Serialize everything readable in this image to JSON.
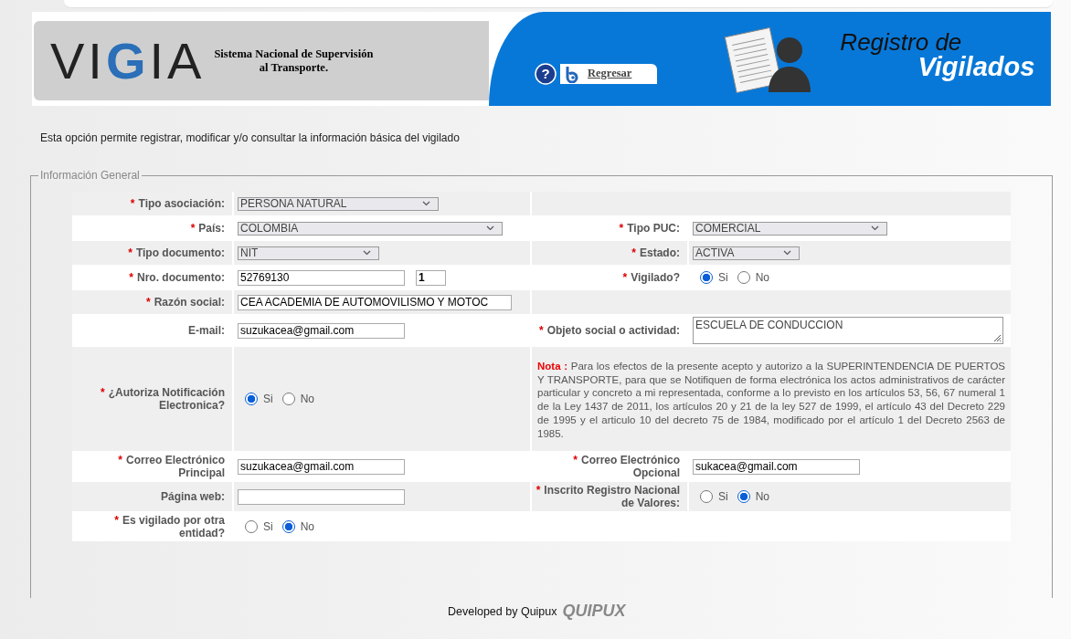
{
  "header": {
    "logo": "VIGIA",
    "system_name": [
      "Sistema Nacional de Supervisión",
      "al Transporte."
    ],
    "help": "?",
    "back_link": "Regresar",
    "title": [
      "Registro de",
      "Vigilados"
    ]
  },
  "intro": "Esta opción permite registrar, modificar y/o consultar la información básica del vigilado",
  "section": {
    "legend": "Información General",
    "rows": [
      {
        "left": {
          "label": "Tipo asociación:",
          "required_mark": "*",
          "kind": "select",
          "value": "PERSONA NATURAL"
        },
        "right": null
      },
      {
        "left": {
          "label": "País:",
          "required_mark": "*",
          "kind": "select",
          "value": "COLOMBIA"
        },
        "right": {
          "label": "Tipo PUC:",
          "required_mark": "*",
          "kind": "select",
          "value": "COMERCIAL"
        }
      },
      {
        "left": {
          "label": "Tipo documento:",
          "required_mark": "*",
          "kind": "select",
          "value": "NIT"
        },
        "right": {
          "label": "Estado:",
          "required_mark": "*",
          "kind": "select",
          "value": "ACTIVA"
        }
      },
      {
        "left": {
          "label": "Nro. documento:",
          "required_mark": "*",
          "kind": "text_pair",
          "value": "52769130",
          "value_2": "1"
        },
        "right": {
          "label": "Vigilado?",
          "required_mark": "*",
          "kind": "radio",
          "options": [
            {
              "label": "Si",
              "selected": true
            },
            {
              "label": "No",
              "selected": false
            }
          ]
        }
      },
      {
        "left": {
          "label": "Razón social:",
          "required_mark": "*",
          "kind": "text",
          "value": "CEA ACADEMIA DE AUTOMOVILISMO Y MOTOC"
        },
        "right": null
      },
      {
        "left": {
          "label": "E-mail:",
          "kind": "text",
          "value": "suzukacea@gmail.com"
        },
        "right": {
          "label": "Objeto social o actividad:",
          "required_mark": "*",
          "kind": "textarea",
          "value": "ESCUELA DE CONDUCCION"
        }
      },
      {
        "left": {
          "label": "¿Autoriza Notificación Electronica?",
          "required_mark": "*",
          "kind": "radio",
          "options": [
            {
              "label": "Si",
              "selected": true
            },
            {
              "label": "No",
              "selected": false
            }
          ]
        },
        "right": {
          "kind": "note",
          "text": "**Nota :** Para los efectos de la presente acepto y autorizo a la SUPERINTENDENCIA DE PUERTOS Y TRANSPORTE, para que se Notifiquen de forma electrónica los actos administrativos de carácter particular y concreto a mi representada, conforme a lo previsto en los artículos 53, 56, 67 numeral 1 de la Ley 1437 de 2011, los artículos 20 y 21 de la ley 527 de 1999, el artículo 43 del Decreto 229 de 1995 y el articulo 10 del decreto 75 de 1984, modificado por el artículo 1 del Decreto 2563 de 1985."
        }
      },
      {
        "left": {
          "label": "Correo Electrónico Principal",
          "required_mark": "*",
          "kind": "text",
          "value": "suzukacea@gmail.com"
        },
        "right": {
          "label": "Correo Electrónico Opcional",
          "required_mark": "*",
          "kind": "text",
          "value": "sukacea@gmail.com"
        }
      },
      {
        "left": {
          "label": "Página web:",
          "kind": "text"
        },
        "right": {
          "label": "Inscrito Registro Nacional de Valores:",
          "required_mark": "*",
          "kind": "radio",
          "options": [
            {
              "label": "Si",
              "selected": false
            },
            {
              "label": "No",
              "selected": true
            }
          ]
        }
      },
      {
        "left": {
          "label": "Es vigilado por otra entidad?",
          "required_mark": "*",
          "kind": "radio",
          "options": [
            {
              "label": "Si",
              "selected": false
            },
            {
              "label": "No",
              "selected": true
            }
          ]
        },
        "right": null
      }
    ]
  },
  "footer": {
    "text": "Developed by Quipux",
    "logo": "QUIPUX"
  }
}
